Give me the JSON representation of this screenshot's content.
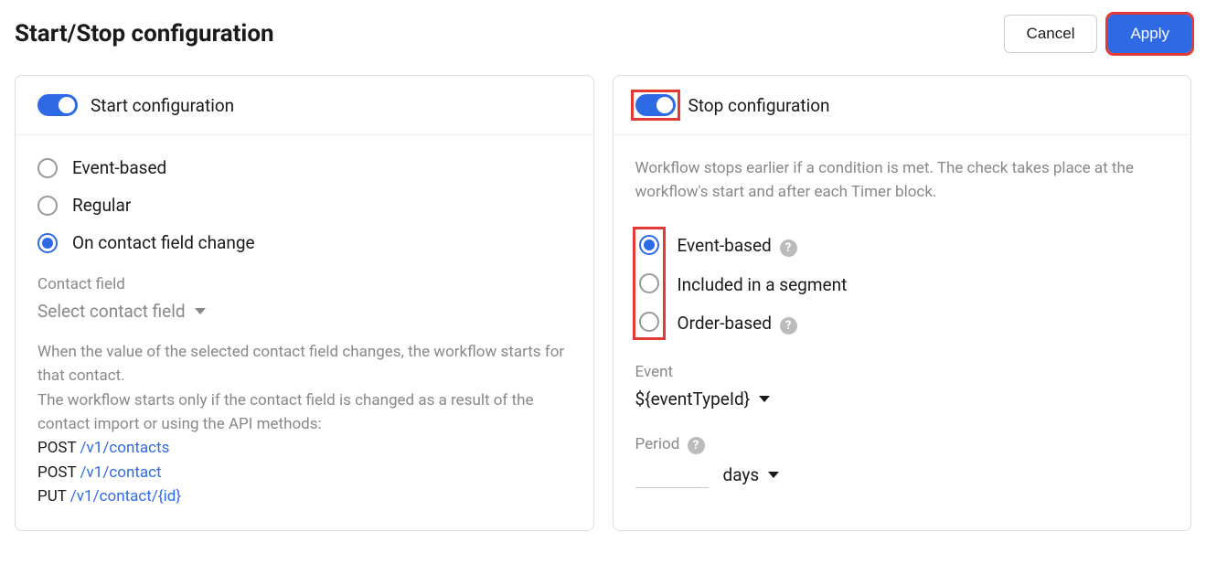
{
  "header": {
    "title": "Start/Stop configuration",
    "cancel_label": "Cancel",
    "apply_label": "Apply"
  },
  "start_panel": {
    "title": "Start configuration",
    "radios": {
      "event_based": "Event-based",
      "regular": "Regular",
      "on_contact_field_change": "On contact field change"
    },
    "contact_field_label": "Contact field",
    "contact_field_placeholder": "Select contact field",
    "help": {
      "line1": "When the value of the selected contact field changes, the workflow starts for that contact.",
      "line2": "The workflow starts only if the contact field is changed as a result of the contact import or using the API methods:",
      "api1_method": "POST ",
      "api1_path": "/v1/contacts",
      "api2_method": "POST ",
      "api2_path": "/v1/contact",
      "api3_method": "PUT ",
      "api3_path": "/v1/contact/{id}"
    }
  },
  "stop_panel": {
    "title": "Stop configuration",
    "description": "Workflow stops earlier if a condition is met. The check takes place at the workflow's start and after each Timer block.",
    "radios": {
      "event_based": "Event-based",
      "included_segment": "Included in a segment",
      "order_based": "Order-based"
    },
    "event_label": "Event",
    "event_value": "${eventTypeId}",
    "period_label": "Period",
    "period_unit": "days"
  }
}
